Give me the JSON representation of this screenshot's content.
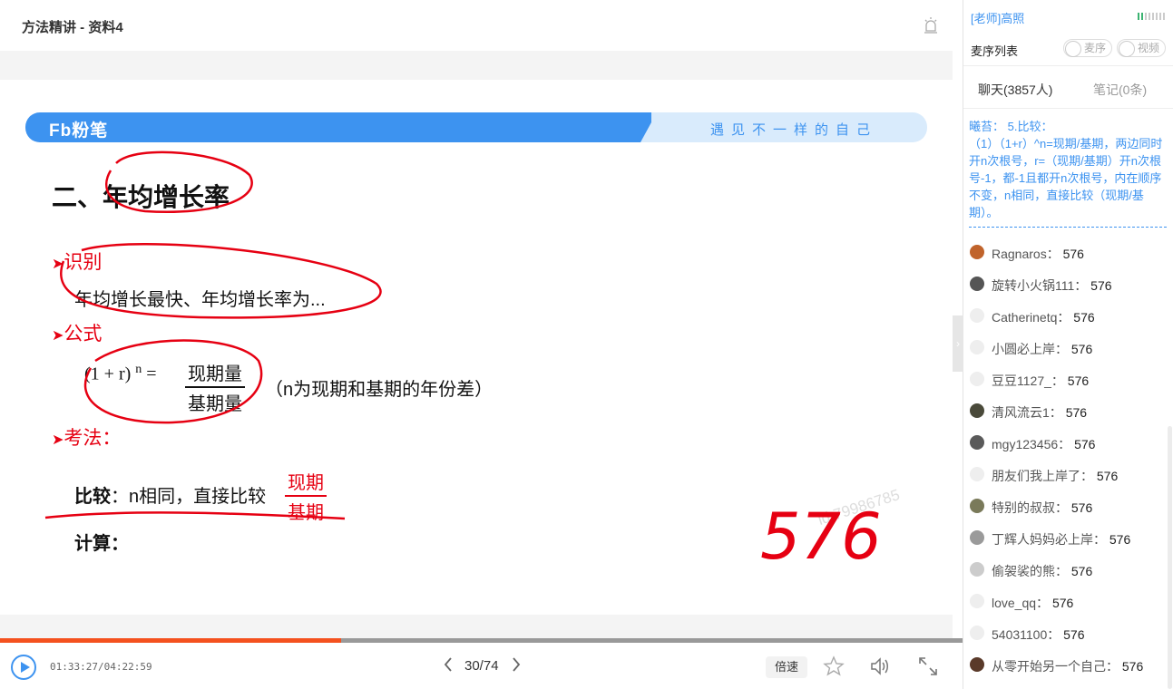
{
  "header": {
    "title": "方法精讲 - 资料4"
  },
  "slide": {
    "banner_logo": "Fb粉笔",
    "banner_slogan": "遇见不一样的自己",
    "heading": "二、年均增长率",
    "section1": "识别",
    "section1_text": "年均增长最快、年均增长率为...",
    "section2": "公式",
    "formula_left": "(1 + r) ",
    "formula_exp": "n",
    "formula_eq": " =",
    "frac_num": "现期量",
    "frac_den": "基期量",
    "formula_note": "（n为现期和基期的年份差）",
    "section3": "考法：",
    "compare_label": "比较",
    "compare_text": "：n相同，直接比较",
    "compare_num": "现期",
    "compare_den": "基期",
    "calc_label": "计算：",
    "handwriting": "576",
    "watermark": "id:79986785"
  },
  "player": {
    "progress": 0.3546,
    "time": "01:33:27/04:22:59",
    "page": "30/74",
    "prev_icon": "chevron-left-icon",
    "next_icon": "chevron-right-icon",
    "speed_label": "倍速",
    "accent_color": "#f4511e"
  },
  "sidebar": {
    "teacher": "[老师]高照",
    "mic_title": "麦序列表",
    "toggle_mic": "麦序",
    "toggle_video": "视频",
    "tab_chat": "聊天(3857人)",
    "tab_notes": "笔记(0条)",
    "notice": "曦苔： 5.比较：\n（1）（1+r）^n=现期/基期，两边同时开n次根号，r=（现期/基期）开n次根号-1，都-1且都开n次根号，内在顺序不变，n相同，直接比较（现期/基期）。",
    "messages": [
      {
        "name": "Ragnaros：",
        "text": "576",
        "avatar": "#c0632b"
      },
      {
        "name": "旋转小火锅111：",
        "text": "576",
        "avatar": "#555555"
      },
      {
        "name": "Catherinetq：",
        "text": "576",
        "avatar": "#eeeeee"
      },
      {
        "name": "小圆必上岸：",
        "text": "576",
        "avatar": "#eeeeee"
      },
      {
        "name": "豆豆1127_：",
        "text": "576",
        "avatar": "#eeeeee"
      },
      {
        "name": "清风流云1：",
        "text": "576",
        "avatar": "#4a4a3a"
      },
      {
        "name": "mgy123456：",
        "text": "576",
        "avatar": "#5a5a5a"
      },
      {
        "name": "朋友们我上岸了：",
        "text": "576",
        "avatar": "#eeeeee"
      },
      {
        "name": "特别的叔叔：",
        "text": "576",
        "avatar": "#7a7a5a"
      },
      {
        "name": "丁辉人妈妈必上岸：",
        "text": "576",
        "avatar": "#9a9a9a"
      },
      {
        "name": "偷袈裟的熊：",
        "text": "576",
        "avatar": "#cccccc"
      },
      {
        "name": "love_qq：",
        "text": "576",
        "avatar": "#eeeeee"
      },
      {
        "name": "54031100：",
        "text": "576",
        "avatar": "#eeeeee"
      },
      {
        "name": "从零开始另一个自己：",
        "text": "576",
        "avatar": "#5a3a2a"
      }
    ]
  }
}
